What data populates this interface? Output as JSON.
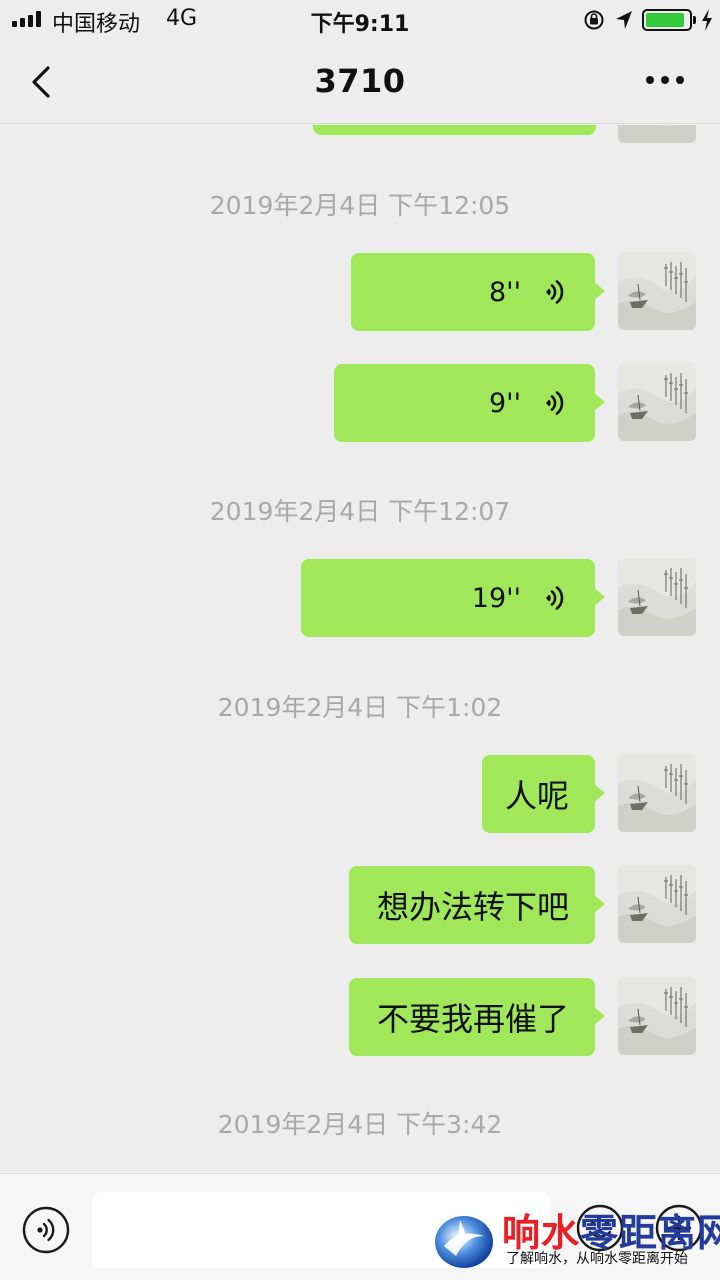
{
  "status_bar": {
    "carrier": "中国移动",
    "network": "4G",
    "time": "下午9:11",
    "battery_fraction": 0.9,
    "battery_color": "#32c93c"
  },
  "nav": {
    "title": "3710",
    "back_icon": "chevron-left-icon",
    "more_icon": "more-dots-icon"
  },
  "theme": {
    "bubble_color": "#a0e75a",
    "background": "#ededed",
    "timestamp_color": "#a8a8a8"
  },
  "messages": [
    {
      "type": "timestamp",
      "text": "2019年2月4日 下午12:05"
    },
    {
      "type": "voice",
      "duration": "8''",
      "icon": "voice-wave-icon"
    },
    {
      "type": "voice",
      "duration": "9''",
      "icon": "voice-wave-icon"
    },
    {
      "type": "timestamp",
      "text": "2019年2月4日 下午12:07"
    },
    {
      "type": "voice",
      "duration": "19''",
      "icon": "voice-wave-icon"
    },
    {
      "type": "timestamp",
      "text": "2019年2月4日 下午1:02"
    },
    {
      "type": "text",
      "text": "人呢"
    },
    {
      "type": "text",
      "text": "想办法转下吧"
    },
    {
      "type": "text",
      "text": "不要我再催了"
    },
    {
      "type": "timestamp",
      "text": "2019年2月4日 下午3:42"
    }
  ],
  "input_bar": {
    "voice_icon": "voice-input-icon",
    "emoji_icon": "emoji-icon",
    "plus_icon": "plus-circle-icon",
    "text": ""
  },
  "watermark": {
    "name_red": "响水",
    "name_blue": "零距离网",
    "slogan": "了解响水，从响水零距离开始"
  }
}
